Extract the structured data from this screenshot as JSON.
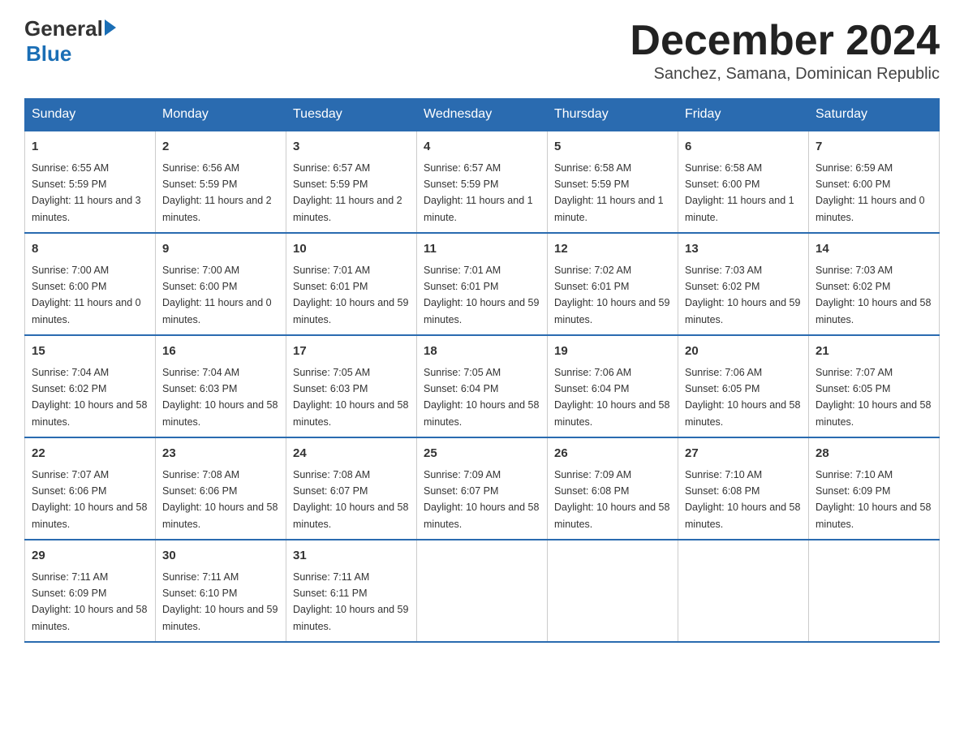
{
  "header": {
    "logo": {
      "general": "General",
      "arrow": "▶",
      "blue": "Blue"
    },
    "month_year": "December 2024",
    "location": "Sanchez, Samana, Dominican Republic"
  },
  "weekdays": [
    "Sunday",
    "Monday",
    "Tuesday",
    "Wednesday",
    "Thursday",
    "Friday",
    "Saturday"
  ],
  "weeks": [
    [
      {
        "day": "1",
        "sunrise": "6:55 AM",
        "sunset": "5:59 PM",
        "daylight": "11 hours and 3 minutes."
      },
      {
        "day": "2",
        "sunrise": "6:56 AM",
        "sunset": "5:59 PM",
        "daylight": "11 hours and 2 minutes."
      },
      {
        "day": "3",
        "sunrise": "6:57 AM",
        "sunset": "5:59 PM",
        "daylight": "11 hours and 2 minutes."
      },
      {
        "day": "4",
        "sunrise": "6:57 AM",
        "sunset": "5:59 PM",
        "daylight": "11 hours and 1 minute."
      },
      {
        "day": "5",
        "sunrise": "6:58 AM",
        "sunset": "5:59 PM",
        "daylight": "11 hours and 1 minute."
      },
      {
        "day": "6",
        "sunrise": "6:58 AM",
        "sunset": "6:00 PM",
        "daylight": "11 hours and 1 minute."
      },
      {
        "day": "7",
        "sunrise": "6:59 AM",
        "sunset": "6:00 PM",
        "daylight": "11 hours and 0 minutes."
      }
    ],
    [
      {
        "day": "8",
        "sunrise": "7:00 AM",
        "sunset": "6:00 PM",
        "daylight": "11 hours and 0 minutes."
      },
      {
        "day": "9",
        "sunrise": "7:00 AM",
        "sunset": "6:00 PM",
        "daylight": "11 hours and 0 minutes."
      },
      {
        "day": "10",
        "sunrise": "7:01 AM",
        "sunset": "6:01 PM",
        "daylight": "10 hours and 59 minutes."
      },
      {
        "day": "11",
        "sunrise": "7:01 AM",
        "sunset": "6:01 PM",
        "daylight": "10 hours and 59 minutes."
      },
      {
        "day": "12",
        "sunrise": "7:02 AM",
        "sunset": "6:01 PM",
        "daylight": "10 hours and 59 minutes."
      },
      {
        "day": "13",
        "sunrise": "7:03 AM",
        "sunset": "6:02 PM",
        "daylight": "10 hours and 59 minutes."
      },
      {
        "day": "14",
        "sunrise": "7:03 AM",
        "sunset": "6:02 PM",
        "daylight": "10 hours and 58 minutes."
      }
    ],
    [
      {
        "day": "15",
        "sunrise": "7:04 AM",
        "sunset": "6:02 PM",
        "daylight": "10 hours and 58 minutes."
      },
      {
        "day": "16",
        "sunrise": "7:04 AM",
        "sunset": "6:03 PM",
        "daylight": "10 hours and 58 minutes."
      },
      {
        "day": "17",
        "sunrise": "7:05 AM",
        "sunset": "6:03 PM",
        "daylight": "10 hours and 58 minutes."
      },
      {
        "day": "18",
        "sunrise": "7:05 AM",
        "sunset": "6:04 PM",
        "daylight": "10 hours and 58 minutes."
      },
      {
        "day": "19",
        "sunrise": "7:06 AM",
        "sunset": "6:04 PM",
        "daylight": "10 hours and 58 minutes."
      },
      {
        "day": "20",
        "sunrise": "7:06 AM",
        "sunset": "6:05 PM",
        "daylight": "10 hours and 58 minutes."
      },
      {
        "day": "21",
        "sunrise": "7:07 AM",
        "sunset": "6:05 PM",
        "daylight": "10 hours and 58 minutes."
      }
    ],
    [
      {
        "day": "22",
        "sunrise": "7:07 AM",
        "sunset": "6:06 PM",
        "daylight": "10 hours and 58 minutes."
      },
      {
        "day": "23",
        "sunrise": "7:08 AM",
        "sunset": "6:06 PM",
        "daylight": "10 hours and 58 minutes."
      },
      {
        "day": "24",
        "sunrise": "7:08 AM",
        "sunset": "6:07 PM",
        "daylight": "10 hours and 58 minutes."
      },
      {
        "day": "25",
        "sunrise": "7:09 AM",
        "sunset": "6:07 PM",
        "daylight": "10 hours and 58 minutes."
      },
      {
        "day": "26",
        "sunrise": "7:09 AM",
        "sunset": "6:08 PM",
        "daylight": "10 hours and 58 minutes."
      },
      {
        "day": "27",
        "sunrise": "7:10 AM",
        "sunset": "6:08 PM",
        "daylight": "10 hours and 58 minutes."
      },
      {
        "day": "28",
        "sunrise": "7:10 AM",
        "sunset": "6:09 PM",
        "daylight": "10 hours and 58 minutes."
      }
    ],
    [
      {
        "day": "29",
        "sunrise": "7:11 AM",
        "sunset": "6:09 PM",
        "daylight": "10 hours and 58 minutes."
      },
      {
        "day": "30",
        "sunrise": "7:11 AM",
        "sunset": "6:10 PM",
        "daylight": "10 hours and 59 minutes."
      },
      {
        "day": "31",
        "sunrise": "7:11 AM",
        "sunset": "6:11 PM",
        "daylight": "10 hours and 59 minutes."
      },
      null,
      null,
      null,
      null
    ]
  ]
}
